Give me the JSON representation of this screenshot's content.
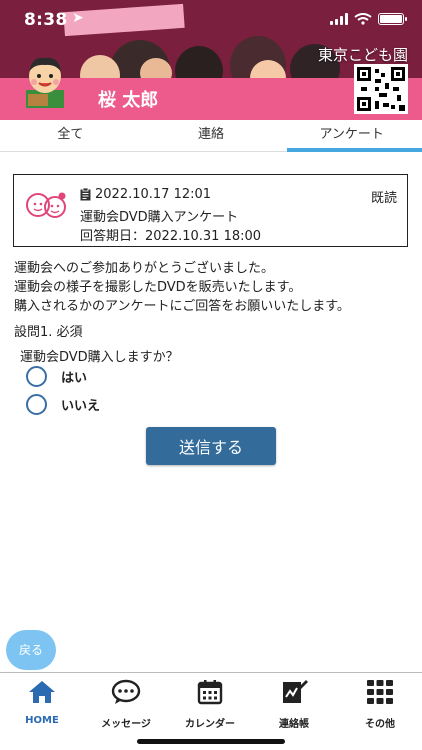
{
  "status_bar": {
    "time": "8:38"
  },
  "header": {
    "school_name": "東京こども園",
    "child_name": "桜 太郎"
  },
  "tabs": [
    {
      "label": "全て"
    },
    {
      "label": "連絡"
    },
    {
      "label": "アンケート"
    }
  ],
  "notice": {
    "datetime": "2022.10.17 12:01",
    "status": "既読",
    "title": "運動会DVD購入アンケート",
    "deadline": "回答期日：2022.10.31 18:00"
  },
  "message": {
    "line1": "運動会へのご参加ありがとうございました。",
    "line2": "運動会の様子を撮影したDVDを販売いたします。",
    "line3": "購入されるかのアンケートにご回答をお願いいたします。"
  },
  "question": {
    "number": "設問1. 必須",
    "text": "運動会DVD購入しますか？",
    "options": [
      {
        "label": "はい"
      },
      {
        "label": "いいえ"
      }
    ]
  },
  "submit_label": "送信する",
  "back_label": "戻る",
  "nav": [
    {
      "label": "HOME",
      "icon": "home-icon"
    },
    {
      "label": "メッセージ",
      "icon": "chat-icon"
    },
    {
      "label": "カレンダー",
      "icon": "calendar-icon"
    },
    {
      "label": "連絡帳",
      "icon": "notebook-icon"
    },
    {
      "label": "その他",
      "icon": "grid-icon"
    }
  ],
  "colors": {
    "banner": "#7a1f3d",
    "pink": "#ec5b8c",
    "tab_active": "#44a7e0",
    "submit": "#336b9b",
    "back": "#7ec4f2",
    "nav_active": "#2a6bb1"
  }
}
